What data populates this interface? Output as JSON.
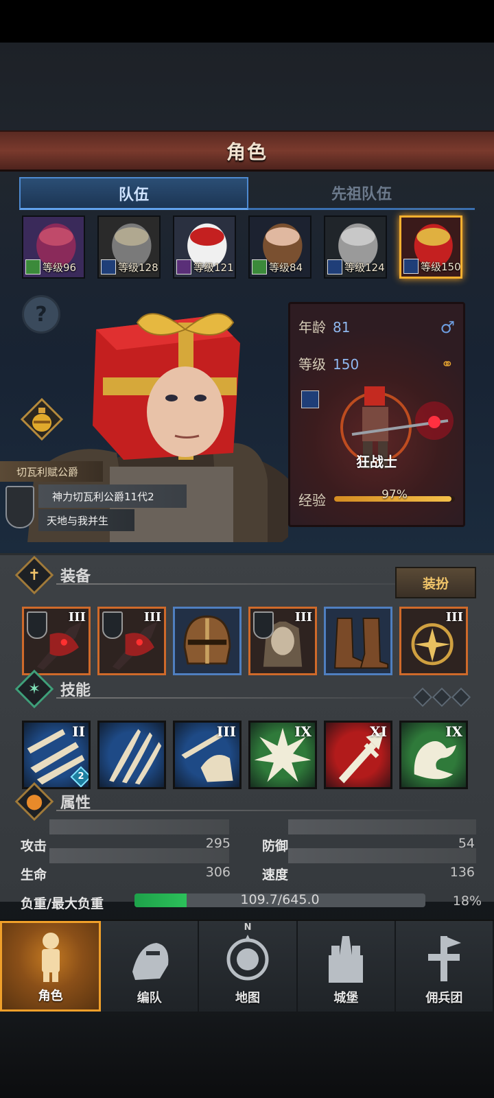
{
  "title": "角色",
  "tabs": [
    {
      "label": "队伍",
      "active": true
    },
    {
      "label": "先祖队伍",
      "active": false
    }
  ],
  "party": [
    {
      "portrait": "turkey-portrait",
      "class_icon": "ranger-icon",
      "class_color": "#3b8a3a",
      "level": "等级96"
    },
    {
      "portrait": "horned-helmet-portrait",
      "class_icon": "sword-icon",
      "class_color": "#1f3e78",
      "level": "等级128"
    },
    {
      "portrait": "snowman-portrait",
      "class_icon": "wand-icon",
      "class_color": "#5a2f78",
      "level": "等级121"
    },
    {
      "portrait": "woman-portrait",
      "class_icon": "ranger-icon",
      "class_color": "#3b8a3a",
      "level": "等级84"
    },
    {
      "portrait": "bucket-helmet-portrait",
      "class_icon": "sword-icon",
      "class_color": "#1f3e78",
      "level": "等级124"
    },
    {
      "portrait": "gift-box-portrait",
      "class_icon": "sword-icon",
      "class_color": "#1f3e78",
      "level": "等级150",
      "selected": true
    }
  ],
  "hero": {
    "house_tag": "切瓦利赋公爵",
    "name": "神力切瓦利公爵11代2",
    "motto": "天地与我并生"
  },
  "info": {
    "age_label": "年龄",
    "age": "81",
    "level_label": "等级",
    "level": "150",
    "gender": "♂",
    "class_name": "狂战士",
    "exp_label": "经验",
    "exp_text": "97%",
    "exp_progress": 0.97
  },
  "equipment": {
    "label": "装备",
    "dress_button": "装扮",
    "slots": [
      {
        "item": "axe-icon",
        "tier": "III",
        "rarity": "orange",
        "locked": true
      },
      {
        "item": "axe-icon",
        "tier": "III",
        "rarity": "orange",
        "locked": true
      },
      {
        "item": "helmet-icon",
        "tier": "",
        "rarity": "blue",
        "locked": false
      },
      {
        "item": "armor-icon",
        "tier": "III",
        "rarity": "orange",
        "locked": true
      },
      {
        "item": "boots-icon",
        "tier": "",
        "rarity": "blue",
        "locked": false
      },
      {
        "item": "amulet-icon",
        "tier": "III",
        "rarity": "orange",
        "locked": false
      }
    ]
  },
  "skills": {
    "label": "技能",
    "items": [
      {
        "icon": "multi-blade-icon",
        "tier": "II",
        "color": "#1e4a86",
        "badge": "2"
      },
      {
        "icon": "claw-slash-icon",
        "tier": "",
        "color": "#1e4a86"
      },
      {
        "icon": "fist-blade-icon",
        "tier": "III",
        "color": "#1e4a86"
      },
      {
        "icon": "burst-icon",
        "tier": "IX",
        "color": "#2f7a3a"
      },
      {
        "icon": "sword-strike-icon",
        "tier": "XI",
        "color": "#b21b1b"
      },
      {
        "icon": "flex-arm-icon",
        "tier": "IX",
        "color": "#2f7a3a"
      }
    ]
  },
  "attributes": {
    "label": "属性",
    "attack_label": "攻击",
    "attack": "295",
    "defense_label": "防御",
    "defense": "54",
    "hp_label": "生命",
    "hp": "306",
    "speed_label": "速度",
    "speed": "136",
    "load_label": "负重/最大负重",
    "load_text": "109.7/645.0",
    "load_percent": "18%",
    "load_progress": 0.18
  },
  "nav": [
    {
      "label": "角色",
      "icon": "knight-icon",
      "active": true
    },
    {
      "label": "编队",
      "icon": "formation-icon",
      "active": false
    },
    {
      "label": "地图",
      "icon": "compass-map-icon",
      "active": false,
      "mark": "N"
    },
    {
      "label": "城堡",
      "icon": "castle-icon",
      "active": false
    },
    {
      "label": "佣兵团",
      "icon": "mercenary-icon",
      "active": false
    }
  ]
}
